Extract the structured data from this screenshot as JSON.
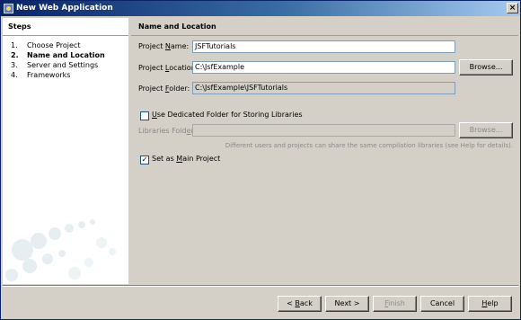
{
  "window": {
    "title": "New Web Application",
    "close_glyph": "×"
  },
  "steps": {
    "title": "Steps",
    "items": [
      {
        "num": "1.",
        "label": "Choose Project"
      },
      {
        "num": "2.",
        "label": "Name and Location"
      },
      {
        "num": "3.",
        "label": "Server and Settings"
      },
      {
        "num": "4.",
        "label": "Frameworks"
      }
    ],
    "current_index": 1
  },
  "content": {
    "title": "Name and Location",
    "project_name": {
      "label_pre": "Project ",
      "label_mnemonic": "N",
      "label_post": "ame:",
      "value": "JSFTutorials"
    },
    "project_location": {
      "label_pre": "Project ",
      "label_mnemonic": "L",
      "label_post": "ocation:",
      "value": "C:\\JsfExample"
    },
    "project_folder": {
      "label_pre": "Project ",
      "label_mnemonic": "F",
      "label_post": "older:",
      "value": "C:\\JsfExample\\JSFTutorials"
    },
    "browse_label": "Browse...",
    "dedicated_folder": {
      "label_pre": "",
      "label_mnemonic": "U",
      "label_post": "se Dedicated Folder for Storing Libraries",
      "checked": false
    },
    "libraries_folder": {
      "label_pre": "Libraries Fold",
      "label_mnemonic": "e",
      "label_post": "r:",
      "value": ""
    },
    "browse_disabled_label": "Browse...",
    "help_text": "Different users and projects can share the same compilation libraries (see Help for details).",
    "main_project": {
      "label_pre": "Set as ",
      "label_mnemonic": "M",
      "label_post": "ain Project",
      "checked": true,
      "check_glyph": "✓"
    }
  },
  "buttons": {
    "back": {
      "pre": "< ",
      "mnemonic": "B",
      "post": "ack"
    },
    "next": "Next >",
    "finish": {
      "pre": "",
      "mnemonic": "F",
      "post": "inish"
    },
    "cancel": "Cancel",
    "help": {
      "pre": "",
      "mnemonic": "H",
      "post": "elp"
    }
  },
  "colors": {
    "title_bar": "#0a246a",
    "dialog_bg": "#d4d0c8",
    "field_border": "#7f9db9"
  }
}
